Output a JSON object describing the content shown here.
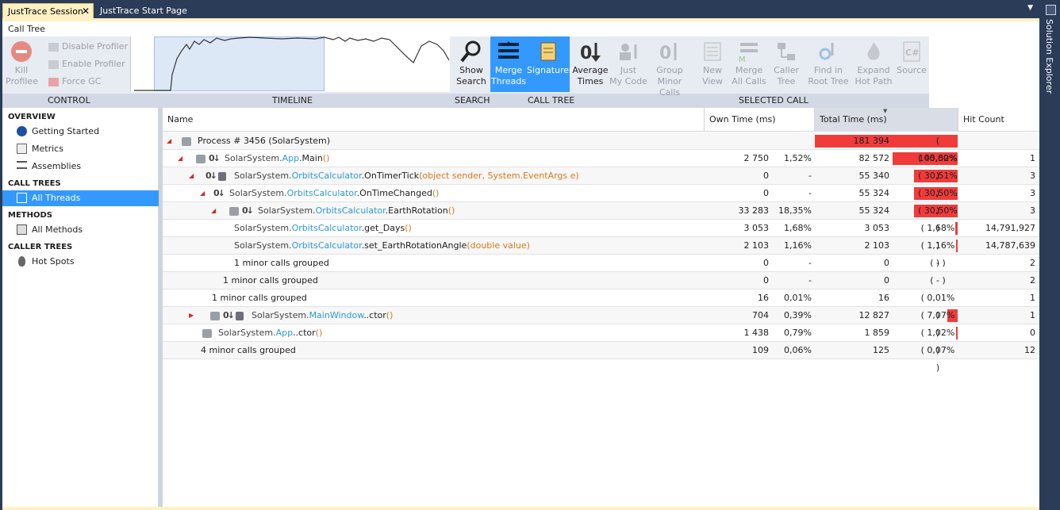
{
  "tabs": {
    "session": "JustTrace Session",
    "start": "JustTrace Start Page"
  },
  "side_panel": {
    "solution_explorer": "Solution Explorer"
  },
  "calltree_tab": "Call Tree",
  "ribbon": {
    "control": {
      "label": "CONTROL",
      "kill": "Kill",
      "kill2": "Profilee",
      "disable": "Disable Profiler",
      "enable": "Enable Profiler",
      "gc": "Force GC"
    },
    "timeline_label": "TIMELINE",
    "search": {
      "label": "SEARCH",
      "b1": "Show",
      "b2": "Search"
    },
    "calltree": {
      "label": "CALL TREE",
      "merge1": "Merge",
      "merge2": "Threads",
      "signatures": "Signatures",
      "avg1": "Average",
      "avg2": "Times"
    },
    "selected": {
      "label": "SELECTED CALL",
      "just1": "Just",
      "just2": "My Code",
      "group1": "Group",
      "group2": "Minor Calls",
      "new1": "New",
      "new2": "View",
      "merge1": "Merge",
      "merge2": "All Calls",
      "caller1": "Caller",
      "caller2": "Tree",
      "find1": "Find in",
      "find2": "Root Tree",
      "expand1": "Expand",
      "expand2": "Hot Path",
      "source": "Source"
    }
  },
  "sidebar": {
    "overview": "OVERVIEW",
    "getting_started": "Getting Started",
    "metrics": "Metrics",
    "assemblies": "Assemblies",
    "call_trees": "CALL TREES",
    "all_threads": "All Threads",
    "methods": "METHODS",
    "all_methods": "All Methods",
    "caller_trees": "CALLER TREES",
    "hot_spots": "Hot Spots"
  },
  "grid": {
    "headers": {
      "name": "Name",
      "own": "Own Time (ms)",
      "total": "Total Time (ms)",
      "hits": "Hit Count"
    },
    "rows": [
      {
        "name": "Process # 3456 (SolarSystem)",
        "own": "",
        "ownp": "",
        "tot": "181 394",
        "totp": "( 100,00% )",
        "hit": "",
        "pct": 1.0
      },
      {
        "pre": "SolarSystem.",
        "cls": "App",
        "mid": ".Main",
        "arg": "()",
        "own": "2 750",
        "ownp": "1,52%",
        "tot": "82 572",
        "totp": "( 45,52% )",
        "hit": "1",
        "pct": 0.4552
      },
      {
        "pre": "SolarSystem.",
        "cls": "OrbitsCalculator",
        "mid": ".OnTimerTick",
        "arg": "(object sender, System.EventArgs e)",
        "own": "0",
        "ownp": "-",
        "tot": "55 340",
        "totp": "( 30,51% )",
        "hit": "3",
        "pct": 0.3051
      },
      {
        "pre": "SolarSystem.",
        "cls": "OrbitsCalculator",
        "mid": ".OnTimeChanged",
        "arg": "()",
        "own": "0",
        "ownp": "-",
        "tot": "55 324",
        "totp": "( 30,50% )",
        "hit": "3",
        "pct": 0.305
      },
      {
        "pre": "SolarSystem.",
        "cls": "OrbitsCalculator",
        "mid": ".EarthRotation",
        "arg": "()",
        "own": "33 283",
        "ownp": "18,35%",
        "tot": "55 324",
        "totp": "( 30,50% )",
        "hit": "3",
        "pct": 0.305
      },
      {
        "pre": "SolarSystem.",
        "cls": "OrbitsCalculator",
        "mid": ".get_Days",
        "arg": "()",
        "own": "3 053",
        "ownp": "1,68%",
        "tot": "3 053",
        "totp": "( 1,68% )",
        "hit": "14,791,927",
        "pct": 0.0168
      },
      {
        "pre": "SolarSystem.",
        "cls": "OrbitsCalculator",
        "mid": ".set_EarthRotationAngle",
        "arg": "(double value)",
        "own": "2 103",
        "ownp": "1,16%",
        "tot": "2 103",
        "totp": "( 1,16% )",
        "hit": "14,787,639",
        "pct": 0.0116
      },
      {
        "name": "1 minor calls grouped",
        "own": "0",
        "ownp": "-",
        "tot": "0",
        "totp": "( - )",
        "hit": "2",
        "pct": 0
      },
      {
        "name": "1 minor calls grouped",
        "own": "0",
        "ownp": "-",
        "tot": "0",
        "totp": "( - )",
        "hit": "2",
        "pct": 0
      },
      {
        "name": "1 minor calls grouped",
        "own": "16",
        "ownp": "0,01%",
        "tot": "16",
        "totp": "( 0,01% )",
        "hit": "1",
        "pct": 0
      },
      {
        "pre": "SolarSystem.",
        "cls": "MainWindow",
        "mid": "..ctor",
        "arg": "()",
        "own": "704",
        "ownp": "0,39%",
        "tot": "12 827",
        "totp": "( 7,07% )",
        "hit": "1",
        "pct": 0.0707
      },
      {
        "pre": "SolarSystem.",
        "cls": "App",
        "mid": "..ctor",
        "arg": "()",
        "own": "1 438",
        "ownp": "0,79%",
        "tot": "1 859",
        "totp": "( 1,02% )",
        "hit": "0",
        "pct": 0.0102
      },
      {
        "name": "4 minor calls grouped",
        "own": "109",
        "ownp": "0,06%",
        "tot": "125",
        "totp": "( 0,07% )",
        "hit": "12",
        "pct": 0
      }
    ]
  }
}
